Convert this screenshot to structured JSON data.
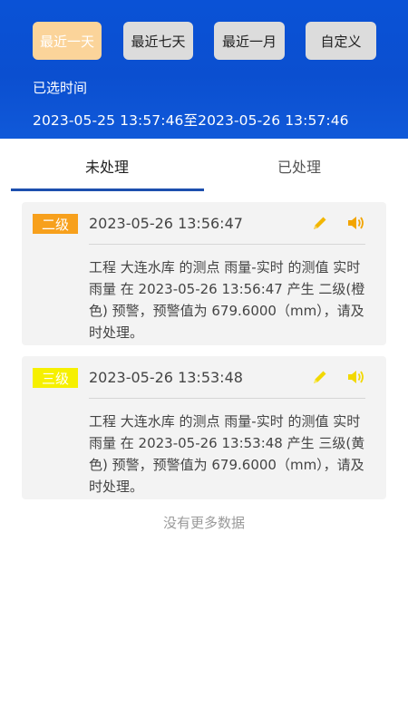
{
  "header": {
    "range_buttons": [
      {
        "label": "最近一天",
        "active": true
      },
      {
        "label": "最近七天",
        "active": false
      },
      {
        "label": "最近一月",
        "active": false
      },
      {
        "label": "自定义",
        "active": false
      }
    ],
    "selected_label": "已选时间",
    "selected_range": "2023-05-25 13:57:46至2023-05-26 13:57:46"
  },
  "tabs": [
    {
      "label": "未处理",
      "active": true
    },
    {
      "label": "已处理",
      "active": false
    }
  ],
  "alerts": [
    {
      "level": "二级",
      "level_color": "#f7a01c",
      "time": "2023-05-26 13:56:47",
      "text": "工程 大连水库 的测点 雨量-实时 的测值 实时雨量 在 2023-05-26 13:56:47 产生 二级(橙色) 预警，预警值为 679.6000（mm），请及时处理。"
    },
    {
      "level": "三级",
      "level_color": "#f6f000",
      "time": "2023-05-26 13:53:48",
      "text": "工程 大连水库 的测点 雨量-实时 的测值 实时雨量 在 2023-05-26 13:53:48 产生 三级(黄色) 预警，预警值为 679.6000（mm），请及时处理。"
    }
  ],
  "footer": {
    "no_more": "没有更多数据"
  },
  "colors": {
    "header_blue": "#0b4fd0",
    "accent_orange": "#f7a01c",
    "icon_yellow": "#f2c200",
    "tab_indicator": "#1d4fae"
  },
  "icons": {
    "edit": "pencil-icon",
    "alarm": "speaker-icon"
  }
}
